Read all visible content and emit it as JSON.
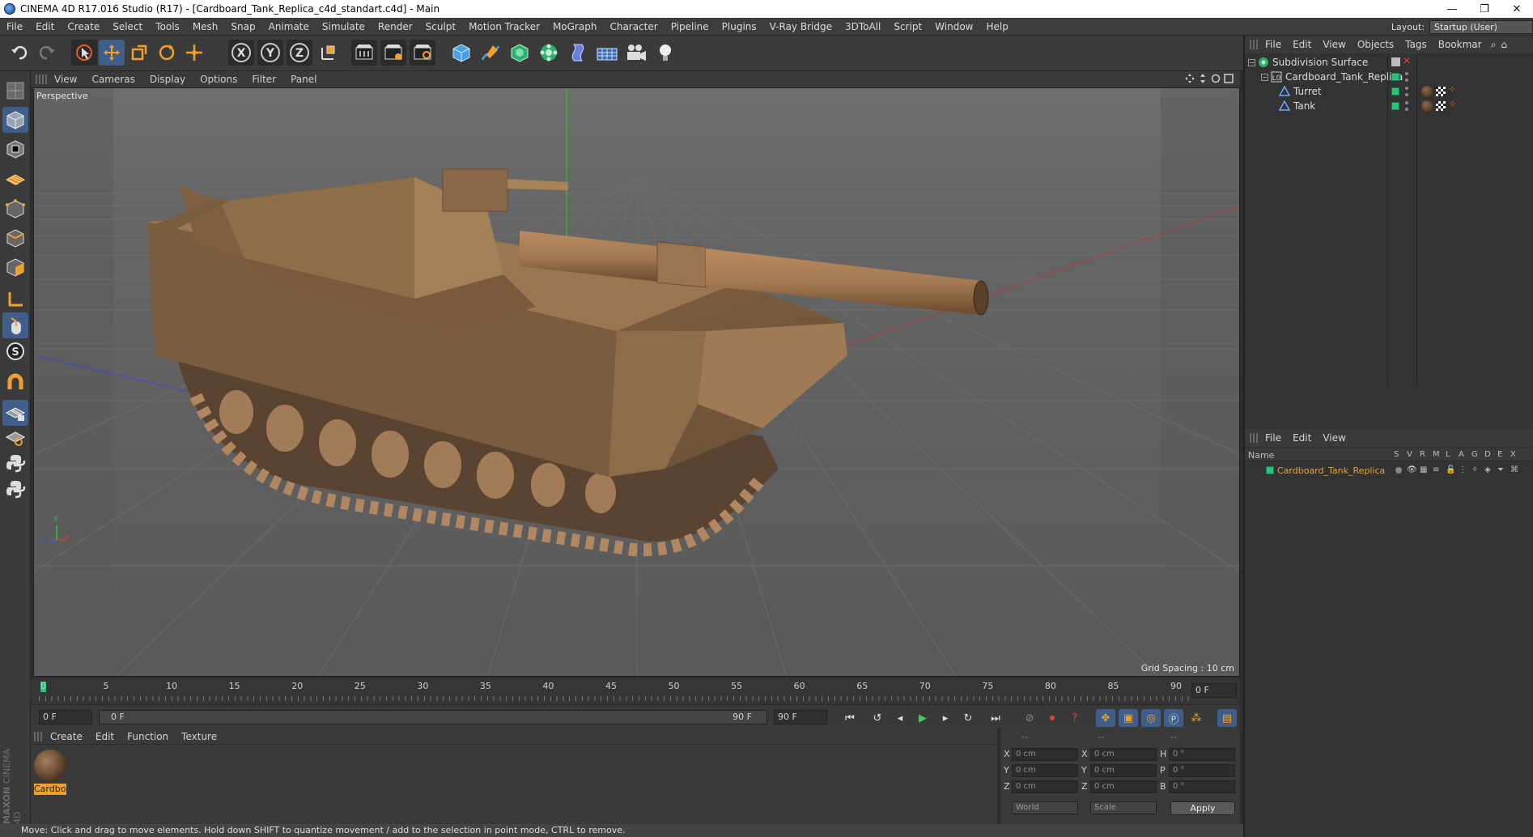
{
  "window": {
    "title": "CINEMA 4D R17.016 Studio (R17) - [Cardboard_Tank_Replica_c4d_standart.c4d] - Main",
    "minimize": "—",
    "restore": "❐",
    "close": "✕"
  },
  "menubar": {
    "items": [
      "File",
      "Edit",
      "Create",
      "Select",
      "Tools",
      "Mesh",
      "Snap",
      "Animate",
      "Simulate",
      "Render",
      "Sculpt",
      "Motion Tracker",
      "MoGraph",
      "Character",
      "Pipeline",
      "Plugins",
      "V-Ray Bridge",
      "3DToAll",
      "Script",
      "Window",
      "Help"
    ],
    "layout_label": "Layout:",
    "layout_value": "Startup (User)"
  },
  "toolbar": {
    "axis_x": "X",
    "axis_y": "Y",
    "axis_z": "Z"
  },
  "viewport": {
    "menu": [
      "View",
      "Cameras",
      "Display",
      "Options",
      "Filter",
      "Panel"
    ],
    "label": "Perspective",
    "grid_spacing": "Grid Spacing : 10 cm",
    "axis_y": "Y",
    "axis_x": "X",
    "axis_z": "Z"
  },
  "timeline": {
    "ticks": [
      "0",
      "5",
      "10",
      "15",
      "20",
      "25",
      "30",
      "35",
      "40",
      "45",
      "50",
      "55",
      "60",
      "65",
      "70",
      "75",
      "80",
      "85",
      "90"
    ],
    "current_frame_right": "0 F",
    "start_field": "0 F",
    "range_start": "0 F",
    "range_end": "90 F",
    "end_field": "90 F"
  },
  "material_panel": {
    "menu": [
      "Create",
      "Edit",
      "Function",
      "Texture"
    ],
    "material_name": "Cardboa"
  },
  "coordinates": {
    "header": [
      "--",
      "--",
      "--"
    ],
    "rows": [
      {
        "l1": "X",
        "v1": "0 cm",
        "l2": "X",
        "v2": "0 cm",
        "l3": "H",
        "v3": "0 °"
      },
      {
        "l1": "Y",
        "v1": "0 cm",
        "l2": "Y",
        "v2": "0 cm",
        "l3": "P",
        "v3": "0 °"
      },
      {
        "l1": "Z",
        "v1": "0 cm",
        "l2": "Z",
        "v2": "0 cm",
        "l3": "B",
        "v3": "0 °"
      }
    ],
    "mode_world": "World",
    "mode_scale": "Scale",
    "apply": "Apply"
  },
  "status_bar": "Move: Click and drag to move elements. Hold down SHIFT to quantize movement / add to the selection in point mode, CTRL to remove.",
  "object_manager": {
    "menu": [
      "File",
      "Edit",
      "View",
      "Objects",
      "Tags",
      "Bookmar"
    ],
    "objects": [
      {
        "name": "Subdivision Surface",
        "level": 0
      },
      {
        "name": "Cardboard_Tank_Replica",
        "level": 1
      },
      {
        "name": "Turret",
        "level": 2
      },
      {
        "name": "Tank",
        "level": 2
      }
    ]
  },
  "layer_manager": {
    "menu": [
      "File",
      "Edit",
      "View"
    ],
    "columns": [
      "Name",
      "S",
      "V",
      "R",
      "M",
      "L",
      "A",
      "G",
      "D",
      "E",
      "X"
    ],
    "layer_name": "Cardboard_Tank_Replica",
    "accent": "#e8a23a"
  },
  "branding": {
    "maxon": "MAXON",
    "c4d": "CINEMA 4D"
  }
}
